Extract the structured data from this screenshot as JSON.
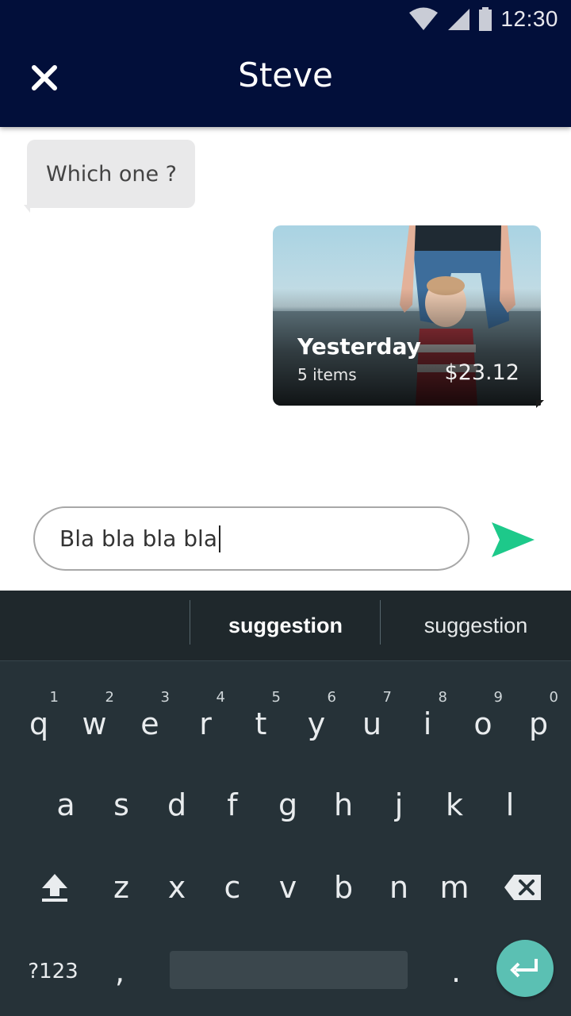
{
  "status_bar": {
    "time": "12:30"
  },
  "header": {
    "title": "Steve"
  },
  "messages": {
    "incoming_text": "Which one ?",
    "card": {
      "title": "Yesterday",
      "subtitle": "5 items",
      "price": "$23.12"
    }
  },
  "composer": {
    "value": "Bla bla bla bla"
  },
  "keyboard": {
    "suggestions": [
      "",
      "suggestion",
      "suggestion"
    ],
    "row1": [
      {
        "k": "q",
        "h": "1"
      },
      {
        "k": "w",
        "h": "2"
      },
      {
        "k": "e",
        "h": "3"
      },
      {
        "k": "r",
        "h": "4"
      },
      {
        "k": "t",
        "h": "5"
      },
      {
        "k": "y",
        "h": "6"
      },
      {
        "k": "u",
        "h": "7"
      },
      {
        "k": "i",
        "h": "8"
      },
      {
        "k": "o",
        "h": "9"
      },
      {
        "k": "p",
        "h": "0"
      }
    ],
    "row2": [
      "a",
      "s",
      "d",
      "f",
      "g",
      "h",
      "j",
      "k",
      "l"
    ],
    "row3": [
      "z",
      "x",
      "c",
      "v",
      "b",
      "n",
      "m"
    ],
    "symbols_label": "?123",
    "comma": ",",
    "period": "."
  },
  "colors": {
    "appbar": "#020f3a",
    "send": "#1dc98a",
    "keyboard_bg": "#263238",
    "enter": "#5bc0b3"
  }
}
